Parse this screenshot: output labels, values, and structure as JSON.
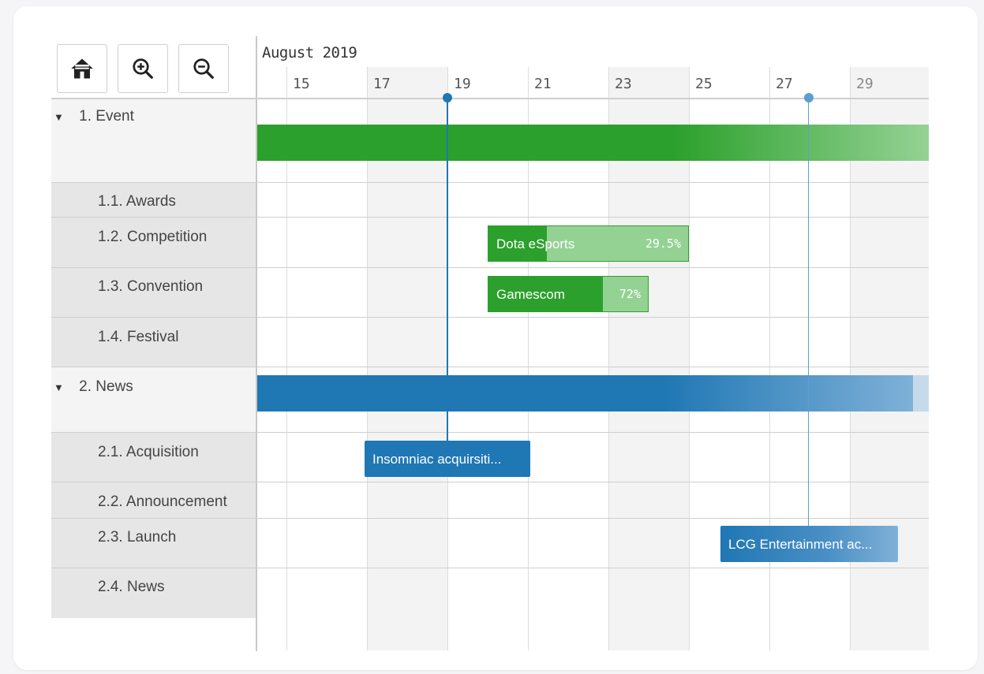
{
  "toolbar": {
    "home": {
      "icon": "home-icon"
    },
    "zoom_in": {
      "icon": "zoom-in-icon"
    },
    "zoom_out": {
      "icon": "zoom-out-icon"
    }
  },
  "timeline": {
    "month": "August 2019",
    "days": [
      "15",
      "17",
      "19",
      "21",
      "23",
      "25",
      "27",
      "29"
    ]
  },
  "rows": {
    "event": {
      "label": "1. Event",
      "expanded_icon": "caret-down-icon"
    },
    "awards": {
      "label": "1.1. Awards"
    },
    "competition": {
      "label": "1.2. Competition"
    },
    "convention": {
      "label": "1.3. Convention"
    },
    "festival": {
      "label": "1.4. Festival"
    },
    "news": {
      "label": "2. News",
      "expanded_icon": "caret-down-icon"
    },
    "acquisition": {
      "label": "2.1. Acquisition"
    },
    "announcement": {
      "label": "2.2. Announcement"
    },
    "launch": {
      "label": "2.3. Launch"
    },
    "news_sub": {
      "label": "2.4. News"
    }
  },
  "tasks": {
    "dota": {
      "name": "Dota eSports",
      "progress": "29.5%"
    },
    "gamescom": {
      "name": "Gamescom",
      "progress": "72%"
    },
    "insomniac": {
      "name": "Insomniac acquirsiti..."
    },
    "lcg": {
      "name": "LCG Entertainment ac..."
    }
  },
  "colors": {
    "event_green": "#2ca02c",
    "event_green_light": "#94d294",
    "news_blue": "#1f77b4",
    "news_blue_light": "#c5dbeb",
    "marker_blue": "#1f77b4",
    "marker_blue_light": "#5a9fd0",
    "weekend_shade": "#f3f3f3",
    "label_bg_parent": "#f4f4f4",
    "label_bg_child": "#e6e6e6"
  }
}
